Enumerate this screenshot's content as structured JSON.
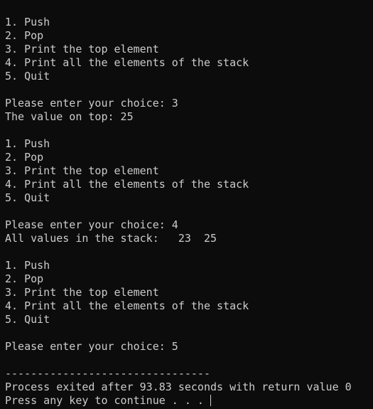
{
  "colors": {
    "background": "#0c0c0c",
    "text": "#cccccc"
  },
  "console": {
    "lines": [
      "1. Push",
      "2. Pop",
      "3. Print the top element",
      "4. Print all the elements of the stack",
      "5. Quit",
      "",
      "Please enter your choice: 3",
      "The value on top: 25",
      "",
      "1. Push",
      "2. Pop",
      "3. Print the top element",
      "4. Print all the elements of the stack",
      "5. Quit",
      "",
      "Please enter your choice: 4",
      "All values in the stack:   23  25",
      "",
      "1. Push",
      "2. Pop",
      "3. Print the top element",
      "4. Print all the elements of the stack",
      "5. Quit",
      "",
      "Please enter your choice: 5",
      "",
      "--------------------------------",
      "Process exited after 93.83 seconds with return value 0",
      "Press any key to continue . . . "
    ]
  }
}
